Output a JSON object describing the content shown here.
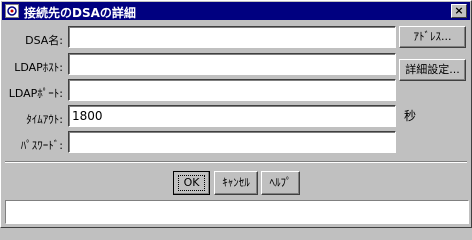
{
  "window": {
    "title": "接続先のDSAの詳細",
    "close_label": "×"
  },
  "form": {
    "dsa_name": {
      "label": "DSA名:",
      "value": ""
    },
    "ldap_host": {
      "label": "LDAPﾎｽﾄ:",
      "value": ""
    },
    "ldap_port": {
      "label": "LDAPﾎﾟｰﾄ:",
      "value": ""
    },
    "timeout": {
      "label": "ﾀｲﾑｱｳﾄ:",
      "value": "1800",
      "unit": "秒"
    },
    "password": {
      "label": "ﾊﾟｽﾜｰﾄﾞ:",
      "value": ""
    }
  },
  "side_buttons": {
    "address": "ｱﾄﾞﾚｽ...",
    "detail_settings": "詳細設定..."
  },
  "bottom_buttons": {
    "ok": "OK",
    "cancel": "ｷｬﾝｾﾙ",
    "help": "ﾍﾙﾌﾟ"
  },
  "status": {
    "text": ""
  }
}
